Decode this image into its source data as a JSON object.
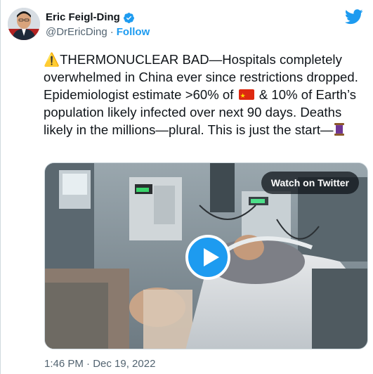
{
  "author": {
    "name": "Eric Feigl-Ding",
    "handle": "@DrEricDing",
    "separator": "·",
    "follow_label": "Follow"
  },
  "tweet": {
    "text_part1": "⚠️THERMONUCLEAR BAD—Hospitals completely overwhelmed in China ever since restrictions dropped. Epidemiologist estimate >60% of ",
    "text_part2": " & 10% of Earth’s population likely infected over next 90 days. Deaths likely in the millions—plural. This is just the start—"
  },
  "media": {
    "watch_label": "Watch on Twitter"
  },
  "timestamp": "1:46 PM · Dec 19, 2022",
  "colors": {
    "accent": "#1d9bf0",
    "text": "#0f1419",
    "secondary_text": "#536471"
  },
  "icons": [
    "verified-badge-icon",
    "twitter-logo-icon",
    "china-flag-icon",
    "thread-spool-icon",
    "play-icon"
  ]
}
